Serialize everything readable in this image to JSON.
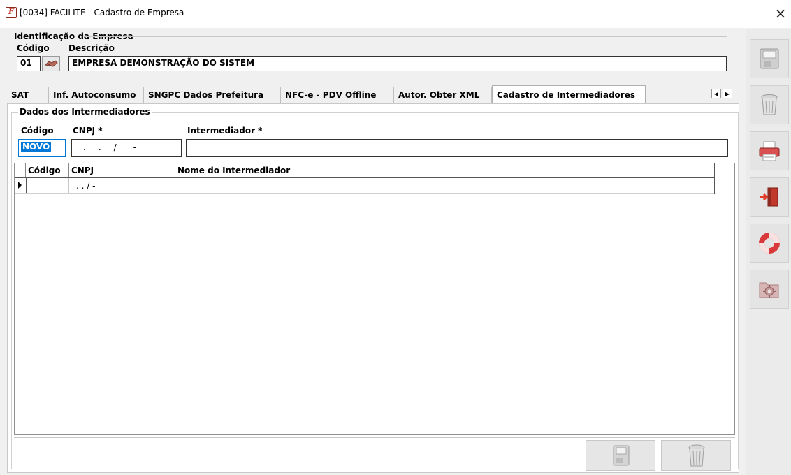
{
  "window": {
    "title": "[0034] FACILITE - Cadastro de Empresa",
    "close_label": "×"
  },
  "identificacao": {
    "legend": "Identificação da Empresa",
    "codigo_label": "Código",
    "descricao_label": "Descrição",
    "codigo_value": "01",
    "descricao_value": "EMPRESA DEMONSTRAÇÃO DO SISTEM"
  },
  "tabs": [
    {
      "label": "SAT"
    },
    {
      "label": "Inf. Autoconsumo"
    },
    {
      "label": "SNGPC Dados Prefeitura"
    },
    {
      "label": "NFC-e - PDV Offline"
    },
    {
      "label": "Autor. Obter XML"
    },
    {
      "label": "Cadastro de Intermediadores"
    }
  ],
  "intermediadores": {
    "legend": "Dados dos Intermediadores",
    "codigo_label": "Código",
    "cnpj_label": "CNPJ *",
    "intermediador_label": "Intermediador *",
    "codigo_value": "NOVO",
    "cnpj_value": "__.___.___/____-__",
    "intermediador_value": ""
  },
  "grid": {
    "headers": [
      "Código",
      "CNPJ",
      "Nome do Intermediador"
    ],
    "rows": [
      {
        "codigo": "",
        "cnpj": ". . /  -",
        "nome": ""
      }
    ]
  },
  "sidebar_icons": [
    "save-icon",
    "trash-icon",
    "printer-icon",
    "exit-door-icon",
    "lifebuoy-icon",
    "settings-folder-icon"
  ],
  "colors": {
    "window_bg": "#f0f0f0",
    "selection_blue": "#0078d7",
    "lifebuoy_red": "#d9393b",
    "exit_red": "#e23b2a"
  }
}
